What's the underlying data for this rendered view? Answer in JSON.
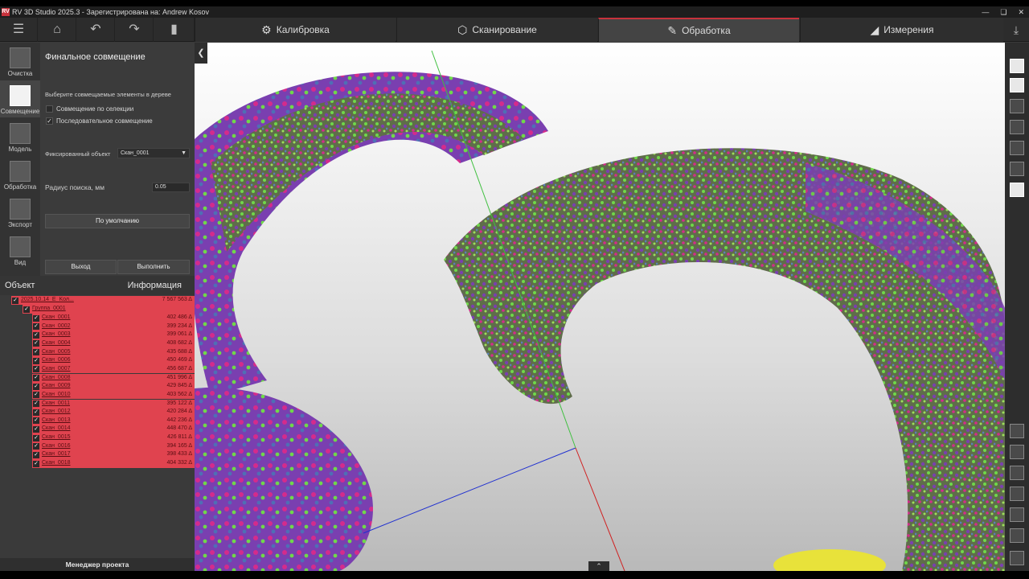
{
  "window": {
    "logo": "RV",
    "title": "RV 3D Studio 2025.3 - Зарегистрирована на: Andrew Kosov"
  },
  "toolbar": {
    "tabs": [
      {
        "label": "Калибровка",
        "icon": "gear-icon",
        "active": false
      },
      {
        "label": "Сканирование",
        "icon": "cube-icon",
        "active": false
      },
      {
        "label": "Обработка",
        "icon": "ruler-pencil-icon",
        "active": true
      },
      {
        "label": "Измерения",
        "icon": "triangle-ruler-icon",
        "active": false
      }
    ]
  },
  "sidebar": {
    "items": [
      {
        "label": "Очистка",
        "active": false
      },
      {
        "label": "Совмещение",
        "active": true
      },
      {
        "label": "Модель",
        "active": false
      },
      {
        "label": "Обработка",
        "active": false
      },
      {
        "label": "Экспорт",
        "active": false
      },
      {
        "label": "Вид",
        "active": false
      }
    ]
  },
  "panel": {
    "title": "Финальное совмещение",
    "hint": "Выберите совмещаемые элементы в дереве",
    "selection_align": {
      "label": "Совмещение по селекции",
      "checked": false
    },
    "sequential_align": {
      "label": "Последовательное совмещение",
      "checked": true
    },
    "fixed_object_label": "Фиксированный объект",
    "fixed_object_value": "Скан_0001",
    "search_radius_label": "Радиус поиска, мм",
    "search_radius_value": "0.05",
    "default_button": "По умолчанию",
    "exit_button": "Выход",
    "run_button": "Выполнить"
  },
  "tree": {
    "col_object": "Объект",
    "col_info": "Информация",
    "root": {
      "name": "2025.10.14_E_Kол...",
      "value": "7 567 563 Δ"
    },
    "group": {
      "name": "Группа_0001"
    },
    "scans": [
      {
        "name": "Скан_0001",
        "value": "402 486 Δ"
      },
      {
        "name": "Скан_0002",
        "value": "399 234 Δ"
      },
      {
        "name": "Скан_0003",
        "value": "399 061 Δ"
      },
      {
        "name": "Скан_0004",
        "value": "408 682 Δ"
      },
      {
        "name": "Скан_0005",
        "value": "435 688 Δ"
      },
      {
        "name": "Скан_0006",
        "value": "450 469 Δ"
      },
      {
        "name": "Скан_0007",
        "value": "456 687 Δ"
      },
      {
        "name": "Скан_0008",
        "value": "451 996 Δ"
      },
      {
        "name": "Скан_0009",
        "value": "429 845 Δ"
      },
      {
        "name": "Скан_0010",
        "value": "403 562 Δ"
      },
      {
        "name": "Скан_0011",
        "value": "395 122 Δ"
      },
      {
        "name": "Скан_0012",
        "value": "420 284 Δ"
      },
      {
        "name": "Скан_0013",
        "value": "442 236 Δ"
      },
      {
        "name": "Скан_0014",
        "value": "448 470 Δ"
      },
      {
        "name": "Скан_0015",
        "value": "426 811 Δ"
      },
      {
        "name": "Скан_0016",
        "value": "394 165 Δ"
      },
      {
        "name": "Скан_0017",
        "value": "398 433 Δ"
      },
      {
        "name": "Скан_0018",
        "value": "404 332 Δ"
      }
    ],
    "manager_label": "Менеджер проекта"
  },
  "colors": {
    "accent": "#c8323c",
    "tree_row": "#e0434f",
    "mesh_green": "#6fd84a",
    "mesh_purple": "#7a3fb0",
    "mesh_magenta": "#d42b8c"
  }
}
